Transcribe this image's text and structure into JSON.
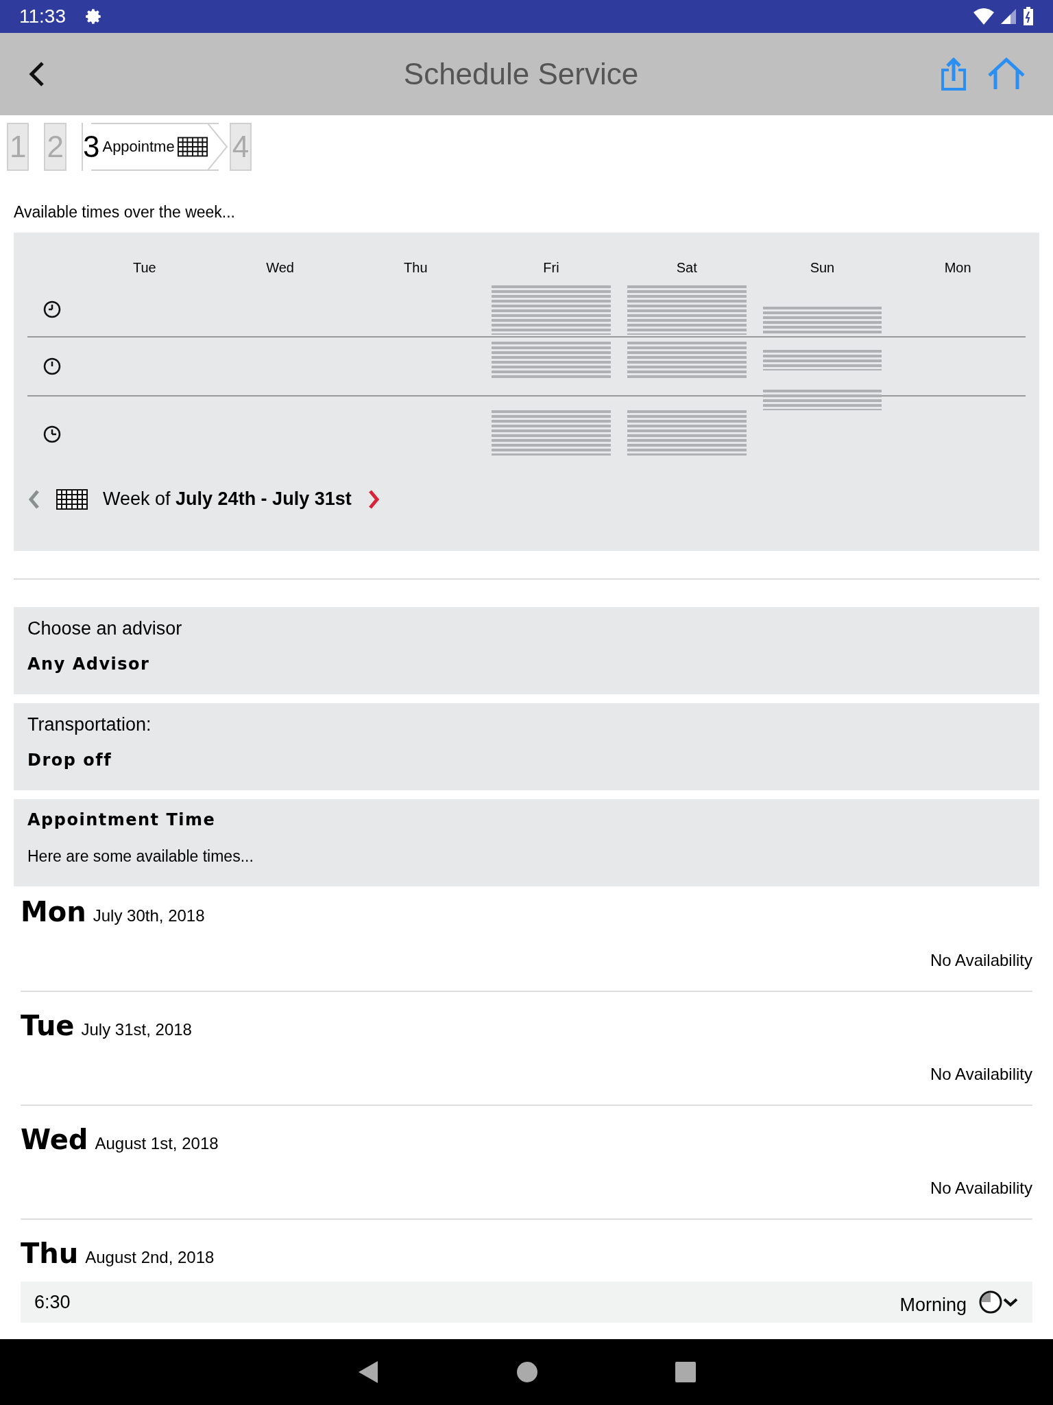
{
  "status_bar": {
    "time": "11:33"
  },
  "app_bar": {
    "title": "Schedule Service"
  },
  "steps": [
    {
      "number": "1",
      "selected": false
    },
    {
      "number": "2",
      "selected": false
    },
    {
      "number": "3",
      "label": "Appointme",
      "selected": true
    },
    {
      "number": "4",
      "selected": false
    }
  ],
  "week_overview": {
    "caption": "Available times over the week...",
    "days": [
      "Tue",
      "Wed",
      "Thu",
      "Fri",
      "Sat",
      "Sun",
      "Mon"
    ],
    "week_prefix": "Week of",
    "week_range": "July 24th - July 31st"
  },
  "advisor": {
    "label": "Choose an advisor",
    "value": "Any Advisor"
  },
  "transportation": {
    "label": "Transportation:",
    "value": "Drop off"
  },
  "appointment_time": {
    "title": "Appointment Time",
    "subtitle": "Here are some available times..."
  },
  "day_sections": [
    {
      "day": "Mon",
      "date": "July 30th, 2018",
      "kind": "none",
      "message": "No Availability"
    },
    {
      "day": "Tue",
      "date": "July 31st, 2018",
      "kind": "none",
      "message": "No Availability"
    },
    {
      "day": "Wed",
      "date": "August 1st, 2018",
      "kind": "none",
      "message": "No Availability"
    },
    {
      "day": "Thu",
      "date": "August 2nd, 2018",
      "kind": "slot",
      "time": "6:30",
      "period": "Morning"
    }
  ]
}
